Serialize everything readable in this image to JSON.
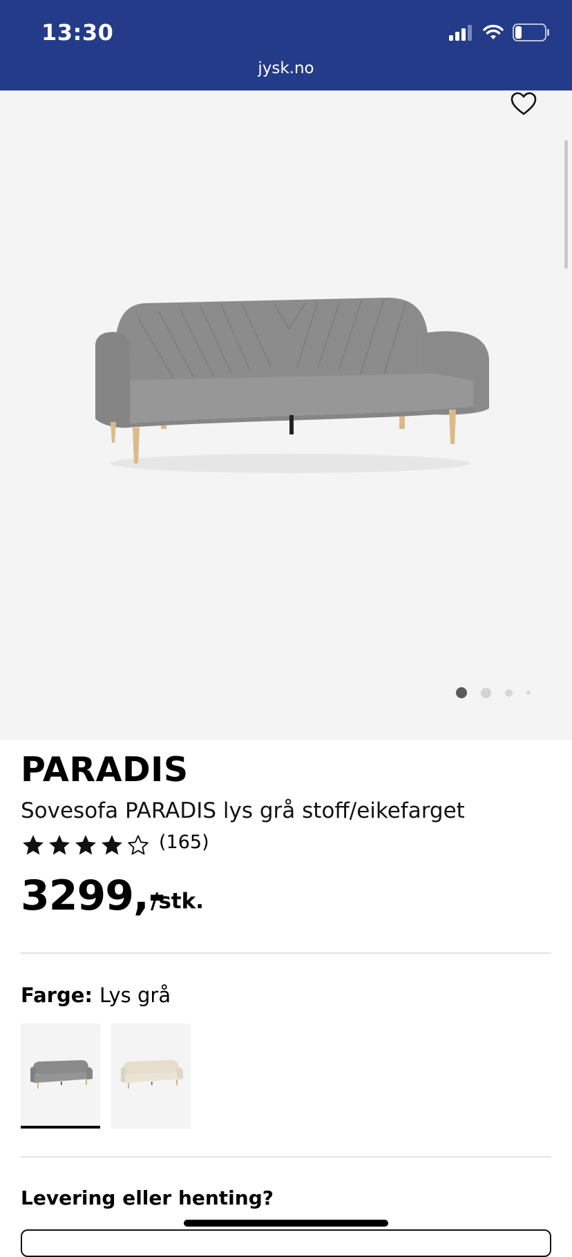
{
  "status_bar": {
    "time": "13:30",
    "url": "jysk.no",
    "battery_level": 0.2,
    "signal_bars": 3
  },
  "gallery": {
    "image_count": 4,
    "active_index": 0
  },
  "product": {
    "brand": "PARADIS",
    "name": "Sovesofa PARADIS lys grå stoff/eikefarget",
    "rating": 4,
    "rating_max": 5,
    "review_count": "(165)",
    "price": "3299,-",
    "unit": "/stk."
  },
  "color": {
    "label": "Farge:",
    "value": "Lys grå",
    "options": [
      {
        "name": "gray",
        "swatch": "#8a8a8a",
        "selected": true
      },
      {
        "name": "beige",
        "swatch": "#e7dfd1",
        "selected": false
      }
    ]
  },
  "delivery": {
    "heading": "Levering eller henting?"
  },
  "colors": {
    "header_bg": "#243b8a",
    "accent": "#000000"
  }
}
